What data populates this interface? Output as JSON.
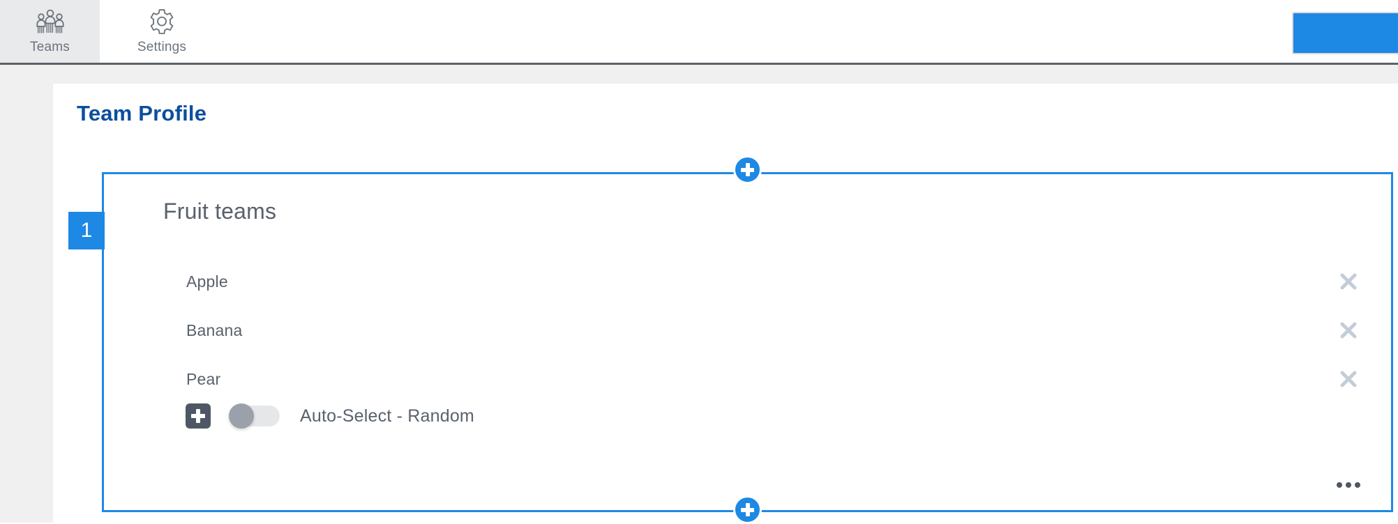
{
  "topbar": {
    "tabs": [
      {
        "label": "Teams",
        "icon": "team-group-icon",
        "active": true
      },
      {
        "label": "Settings",
        "icon": "gear-icon",
        "active": false
      }
    ],
    "action_button": {
      "label": "",
      "icon": "primary-action-button",
      "color": "#1e88e5"
    }
  },
  "page": {
    "title": "Team Profile"
  },
  "group": {
    "step_number": "1",
    "title": "Fruit teams",
    "members": [
      {
        "name": "Apple",
        "remove_icon": "close-icon"
      },
      {
        "name": "Banana",
        "remove_icon": "close-icon"
      },
      {
        "name": "Pear",
        "remove_icon": "close-icon"
      }
    ],
    "auto_select": {
      "add_icon": "plus-square-icon",
      "toggle_state": "off",
      "label": "Auto-Select - Random"
    },
    "overflow_icon": "ellipsis-icon",
    "add_above_icon": "plus-circle-icon",
    "add_below_icon": "plus-circle-icon"
  },
  "colors": {
    "accent": "#1e88e5",
    "title": "#0b4f9e",
    "text": "#59616b",
    "icon_muted": "#c3cdd8",
    "dark_icon": "#4e5864",
    "page_bg": "#f0f0f0"
  }
}
